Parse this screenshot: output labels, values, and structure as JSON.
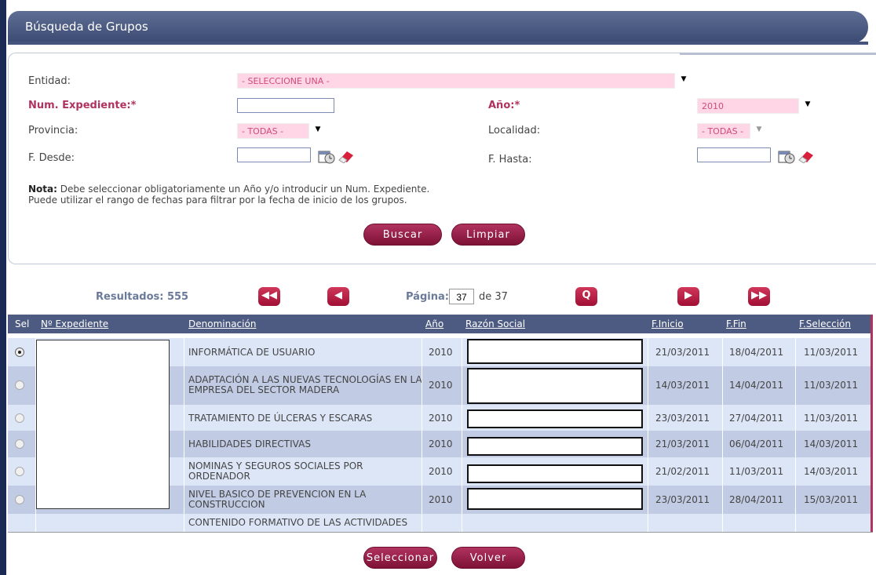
{
  "header": {
    "title": "Búsqueda de Grupos"
  },
  "form": {
    "entidad_label": "Entidad:",
    "entidad_value": "- SELECCIONE UNA -",
    "expediente_label": "Num. Expediente:*",
    "expediente_value": "",
    "anio_label": "Año:*",
    "anio_value": "2010",
    "provincia_label": "Provincia:",
    "provincia_value": "- TODAS -",
    "localidad_label": "Localidad:",
    "localidad_value": "- TODAS -",
    "desde_label": "F. Desde:",
    "hasta_label": "F. Hasta:",
    "note_bold": "Nota:",
    "note_line1": "Debe seleccionar obligatoriamente un Año y/o introducir un Num. Expediente.",
    "note_line2": "Puede utilizar el rango de fechas para filtrar por la fecha de inicio de los grupos.",
    "search_button": "Buscar",
    "clear_button": "Limpiar"
  },
  "pager": {
    "results_label": "Resultados: 555",
    "page_label": "Página:",
    "page_value": "37",
    "page_of": "de 37",
    "first": "◀◀",
    "prev": "◀",
    "search": "Q",
    "next": "▶",
    "last": "▶▶"
  },
  "table": {
    "headers": [
      "Sel",
      "Nº Expediente",
      "Denominación",
      "Año",
      "Razón Social",
      "F.Inicio",
      "F.Fin",
      "F.Selección"
    ],
    "rows": [
      {
        "denominacion": "INFORMÁTICA DE USUARIO",
        "anio": "2010",
        "inicio": "21/03/2011",
        "fin": "18/04/2011",
        "seleccion": "11/03/2011"
      },
      {
        "denominacion": "ADAPTACIÓN A LAS NUEVAS TECNOLOGÍAS EN LA EMPRESA DEL SECTOR MADERA",
        "anio": "2010",
        "inicio": "14/03/2011",
        "fin": "14/04/2011",
        "seleccion": "11/03/2011"
      },
      {
        "denominacion": "TRATAMIENTO DE ÚLCERAS Y ESCARAS",
        "anio": "2010",
        "inicio": "23/03/2011",
        "fin": "27/04/2011",
        "seleccion": "11/03/2011"
      },
      {
        "denominacion": "HABILIDADES DIRECTIVAS",
        "anio": "2010",
        "inicio": "21/03/2011",
        "fin": "06/04/2011",
        "seleccion": "14/03/2011"
      },
      {
        "denominacion": "NOMINAS Y SEGUROS SOCIALES POR ORDENADOR",
        "anio": "2010",
        "inicio": "21/02/2011",
        "fin": "11/03/2011",
        "seleccion": "14/03/2011"
      },
      {
        "denominacion": "NIVEL BASICO DE PREVENCION EN LA CONSTRUCCION",
        "anio": "2010",
        "inicio": "23/03/2011",
        "fin": "28/04/2011",
        "seleccion": "15/03/2011"
      },
      {
        "denominacion": "CONTENIDO FORMATIVO DE LAS ACTIVIDADES",
        "anio": "",
        "inicio": "",
        "fin": "",
        "seleccion": ""
      }
    ]
  },
  "footer": {
    "select_button": "Seleccionar",
    "back_button": "Volver"
  }
}
